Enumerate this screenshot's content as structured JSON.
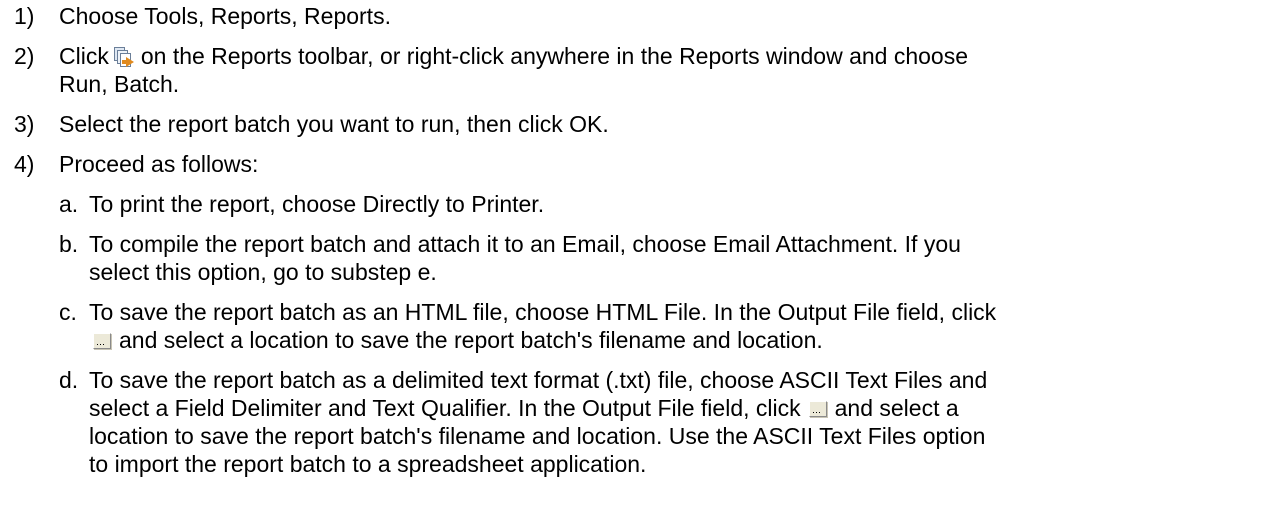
{
  "steps": [
    {
      "num": "1)",
      "lines": [
        "Choose Tools, Reports, Reports."
      ]
    },
    {
      "num": "2)",
      "line1_before_icon": "Click",
      "line1_after_icon": "on the Reports toolbar, or right-click anywhere in the Reports window and choose",
      "line2": "Run, Batch.",
      "icon": "batch-run-icon"
    },
    {
      "num": "3)",
      "lines": [
        "Select the report batch you want to run, then click OK."
      ]
    },
    {
      "num": "4)",
      "lines": [
        "Proceed as follows:"
      ]
    }
  ],
  "substeps": [
    {
      "letter": "a.",
      "lines": [
        "To print the report, choose Directly to Printer."
      ]
    },
    {
      "letter": "b.",
      "lines": [
        "To compile the report batch and attach it to an Email, choose Email Attachment. If you",
        "select this option, go to substep e."
      ]
    },
    {
      "letter": "c.",
      "line1": "To save the report batch as an HTML file, choose HTML File. In the Output File field, click",
      "line2_after_icon": "and select a location to save the report batch's filename and location.",
      "icon": "browse-button-icon"
    },
    {
      "letter": "d.",
      "line1": "To save the report batch as a delimited text format (.txt) file, choose ASCII Text Files and",
      "line2_before_icon": "select a Field Delimiter and Text Qualifier. In the Output File field, click",
      "line2_after_icon": "and select a",
      "line3": "location to save the report batch's filename and location. Use the ASCII Text Files option",
      "line4": "to import the report batch to a spreadsheet application.",
      "icon": "browse-button-icon"
    }
  ]
}
